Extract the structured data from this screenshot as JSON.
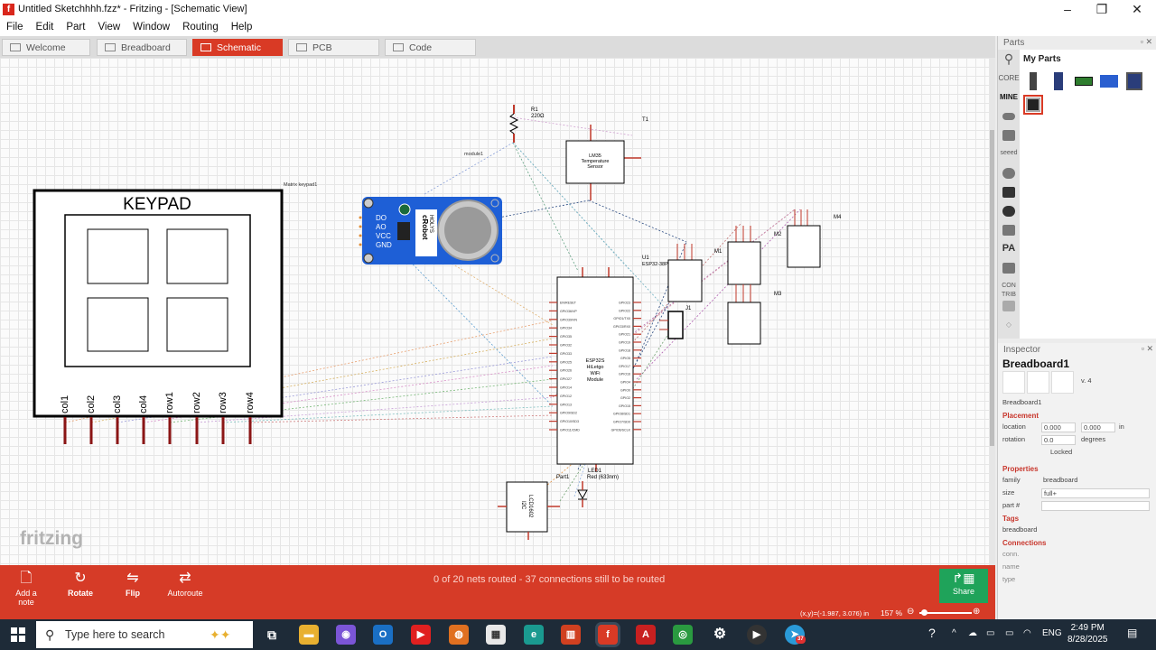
{
  "window": {
    "title": "Untitled Sketchhhh.fzz* - Fritzing - [Schematic View]"
  },
  "menu": [
    "File",
    "Edit",
    "Part",
    "View",
    "Window",
    "Routing",
    "Help"
  ],
  "tabs": [
    {
      "label": "Welcome",
      "icon": "welcome-icon"
    },
    {
      "label": "Breadboard",
      "icon": "breadboard-icon"
    },
    {
      "label": "Schematic",
      "icon": "schematic-icon",
      "active": true
    },
    {
      "label": "PCB",
      "icon": "pcb-icon"
    },
    {
      "label": "Code",
      "icon": "code-icon"
    }
  ],
  "schematic": {
    "keypad": {
      "title": "KEYPAD",
      "part_label": "Matrix keypad1",
      "pins": [
        "col1",
        "col2",
        "col3",
        "col4",
        "row1",
        "row2",
        "row3",
        "row4"
      ]
    },
    "module": {
      "label": "module1",
      "pins": [
        "DO",
        "AO",
        "VCC",
        "GND"
      ],
      "brand": "cRobot",
      "model": "HOLYS"
    },
    "resistor": {
      "label": "R1",
      "value": "220Ω"
    },
    "sensor": {
      "label": "T1",
      "lines": [
        "LM35",
        "Temperature",
        "Sensor"
      ]
    },
    "esp": {
      "label": "U1",
      "sublabel": "ESP32-38PinWide",
      "chip": [
        "ESP32S",
        "HiLetgo",
        "WiFi",
        "Module"
      ],
      "left_pins": [
        "EN/RESET",
        "GPIO36/VP",
        "GPIO39/VN",
        "GPIO34",
        "GPIO35",
        "GPIO32",
        "GPIO33",
        "GPIO25",
        "GPIO26",
        "GPIO27",
        "GPIO14",
        "GPIO12",
        "GPIO13",
        "GPIO9/SD2",
        "GPIO10/SD3",
        "GPIO11/CMD"
      ],
      "right_pins": [
        "GPIO23",
        "GPIO22",
        "GPIO1/TX0",
        "GPIO3/RX0",
        "GPIO21",
        "GPIO19",
        "GPIO18",
        "GPIO5",
        "GPIO17",
        "GPIO16",
        "GPIO4",
        "GPIO0",
        "GPIO2",
        "GPIO15",
        "GPIO8/SD1",
        "GPIO7/SD0",
        "GPIO6/SCLK"
      ]
    },
    "motors": [
      {
        "label": "M1"
      },
      {
        "label": "M2"
      },
      {
        "label": "M3"
      },
      {
        "label": "M4"
      }
    ],
    "jumper": {
      "label": "J1"
    },
    "led": {
      "label": "LED1",
      "value": "Red (633nm)"
    },
    "lcd": {
      "label": "Part1",
      "lines": [
        "LCD1602",
        "I2C"
      ]
    },
    "watermark": "fritzing"
  },
  "toolbar": {
    "add_note": "Add a note",
    "rotate": "Rotate",
    "flip": "Flip",
    "autoroute": "Autoroute",
    "share": "Share",
    "status": "0 of 20 nets routed - 37 connections still to be routed"
  },
  "statusbar": {
    "coords": "(x,y)=(-1.987, 3.076) in",
    "zoom": "157 %"
  },
  "parts": {
    "header": "Parts",
    "bins": [
      "CORE",
      "MINE"
    ],
    "bin_texts": [
      "seeed",
      "CON TRIB"
    ],
    "my_parts": "My Parts"
  },
  "inspector": {
    "header": "Inspector",
    "title": "Breadboard1",
    "version": "v. 4",
    "name": "Breadboard1",
    "placement": "Placement",
    "location_label": "location",
    "location_x": "0.000",
    "location_y": "0.000",
    "location_unit": "in",
    "rotation_label": "rotation",
    "rotation_value": "0.0",
    "rotation_unit": "degrees",
    "locked": "Locked",
    "properties": "Properties",
    "family_label": "family",
    "family_value": "breadboard",
    "size_label": "size",
    "size_value": "full+",
    "part_label": "part #",
    "tags": "Tags",
    "tags_value": "breadboard",
    "connections": "Connections",
    "conn_label": "conn.",
    "name_label": "name",
    "type_label": "type"
  },
  "taskbar": {
    "search_placeholder": "Type here to search",
    "time": "2:49 PM",
    "date": "8/28/2025",
    "lang": "ENG",
    "badge": "37"
  }
}
